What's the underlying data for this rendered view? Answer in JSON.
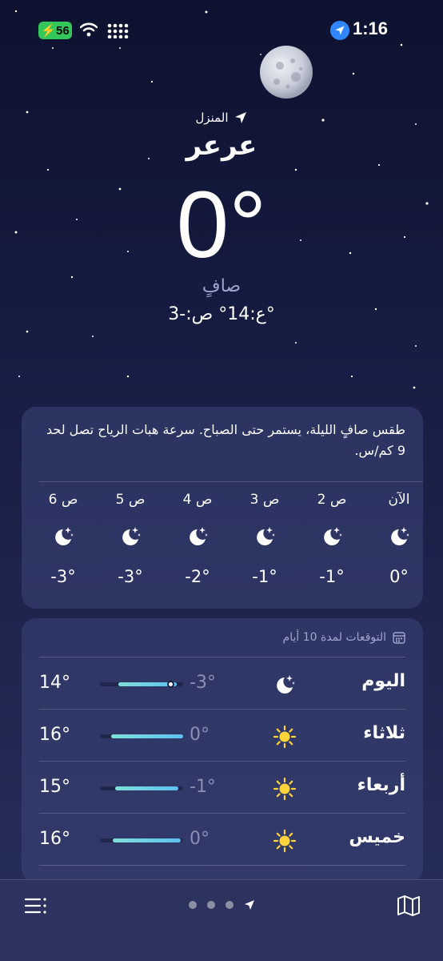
{
  "status_bar": {
    "battery_level": "56",
    "time": "1:16",
    "icons": [
      "charging-bolt-icon",
      "wifi-icon",
      "cellular-signal-icon",
      "location-arrow-icon"
    ]
  },
  "location": {
    "home_label": "المنزل",
    "city": "عرعر",
    "temperature": "0°",
    "condition": "صافٍ",
    "high_low": "ع:14°  ص:-3°"
  },
  "summary": {
    "text": "طقس صافٍ الليلة، يستمر حتى الصباح. سرعة هبات الرياح تصل لحد 9 كم/س."
  },
  "hourly": [
    {
      "label": "الآن",
      "temp": "0°",
      "icon": "moon-stars-icon"
    },
    {
      "label": "2 ص",
      "temp": "-1°",
      "icon": "moon-stars-icon"
    },
    {
      "label": "3 ص",
      "temp": "-1°",
      "icon": "moon-stars-icon"
    },
    {
      "label": "4 ص",
      "temp": "-2°",
      "icon": "moon-stars-icon"
    },
    {
      "label": "5 ص",
      "temp": "-3°",
      "icon": "moon-stars-icon"
    },
    {
      "label": "6 ص",
      "temp": "-3°",
      "icon": "moon-stars-icon"
    }
  ],
  "forecast": {
    "header": "التوقعات لمدة 10 أيام",
    "days": [
      {
        "day": "اليوم",
        "icon": "moon-stars-icon",
        "low": "-3°",
        "high": "14°",
        "range_start": 0.22,
        "range_end": 0.92,
        "current": 0.85
      },
      {
        "day": "ثلاثاء",
        "icon": "sun-icon",
        "low": "0°",
        "high": "16°",
        "range_start": 0.13,
        "range_end": 1.0
      },
      {
        "day": "أربعاء",
        "icon": "sun-icon",
        "low": "-1°",
        "high": "15°",
        "range_start": 0.18,
        "range_end": 0.94
      },
      {
        "day": "خميس",
        "icon": "sun-icon",
        "low": "0°",
        "high": "16°",
        "range_start": 0.15,
        "range_end": 0.97
      }
    ]
  },
  "colors": {
    "accent": "#2f86ff",
    "battery": "#34c759",
    "sun": "#ffd43b",
    "bar_start": "#7fe0d9",
    "bar_end": "#5fc0f0"
  }
}
